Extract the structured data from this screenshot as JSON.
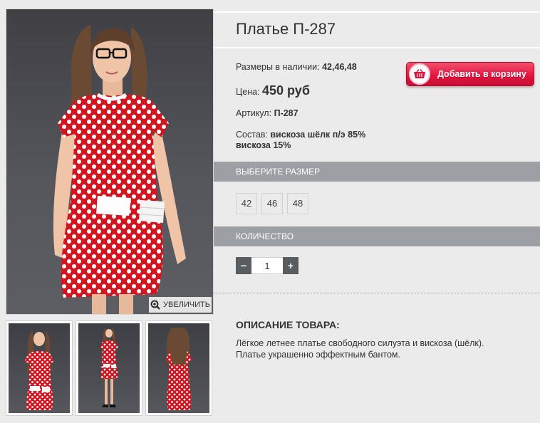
{
  "product": {
    "title": "Платье П-287",
    "sizes_label": "Размеры в наличии:",
    "sizes_value": "42,46,48",
    "price_label": "Цена:",
    "price_value": "450 руб",
    "article_label": "Артикул:",
    "article_value": "П-287",
    "composition_label": "Состав:",
    "composition_line1": "вискоза шёлк п/э 85%",
    "composition_line2": "вискоза 15%"
  },
  "cart": {
    "label": "Добавить в корзину"
  },
  "gallery": {
    "zoom_label": "УВЕЛИЧИТЬ"
  },
  "size_section": {
    "title": "Выберите размер",
    "options": [
      "42",
      "46",
      "48"
    ]
  },
  "quantity_section": {
    "title": "Количество",
    "value": "1",
    "minus": "−",
    "plus": "+"
  },
  "description": {
    "title": "ОПИСАНИЕ ТОВАРА:",
    "line1": "Лёгкое летнее платье свободного силуэта и вискоза (шёлк).",
    "line2": "Платье украшенно эффектным бантом."
  },
  "colors": {
    "dress_red": "#d4141f",
    "cart_button": "#e0133e",
    "section_bar": "#9c9fa3"
  }
}
